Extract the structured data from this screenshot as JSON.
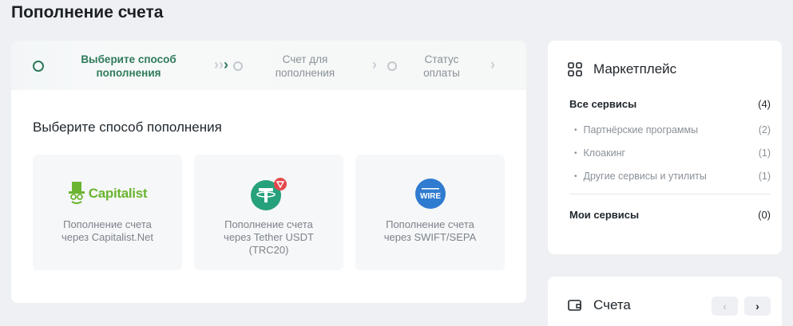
{
  "page": {
    "title": "Пополнение счета"
  },
  "stepper": {
    "steps": [
      {
        "label_line1": "Выберите способ",
        "label_line2": "пополнения"
      },
      {
        "label_line1": "Счет для",
        "label_line2": "пополнения"
      },
      {
        "label_line1": "Статус",
        "label_line2": "оплаты"
      }
    ]
  },
  "methods": {
    "title": "Выберите способ пополнения",
    "items": [
      {
        "logo_text": "Capitalist",
        "desc_line1": "Пополнение счета",
        "desc_line2": "через Capitalist.Net",
        "desc_line3": ""
      },
      {
        "logo_text": "",
        "desc_line1": "Пополнение счета",
        "desc_line2": "через Tether USDT",
        "desc_line3": "(TRC20)"
      },
      {
        "logo_text": "WIRE",
        "desc_line1": "Пополнение счета",
        "desc_line2": "через SWIFT/SEPA",
        "desc_line3": ""
      }
    ]
  },
  "marketplace": {
    "title": "Маркетплейс",
    "all_label": "Все сервисы",
    "all_count": "(4)",
    "items": [
      {
        "name": "Партнёрские программы",
        "count": "(2)"
      },
      {
        "name": "Клоакинг",
        "count": "(1)"
      },
      {
        "name": "Другие сервисы и утилиты",
        "count": "(1)"
      }
    ],
    "my_label": "Мои сервисы",
    "my_count": "(0)"
  },
  "accounts": {
    "title": "Счета"
  },
  "colors": {
    "accent": "#2f7a5a",
    "capitalist_green": "#6bb431",
    "tether": "#26a17b",
    "wire_blue": "#2f7bd0"
  }
}
